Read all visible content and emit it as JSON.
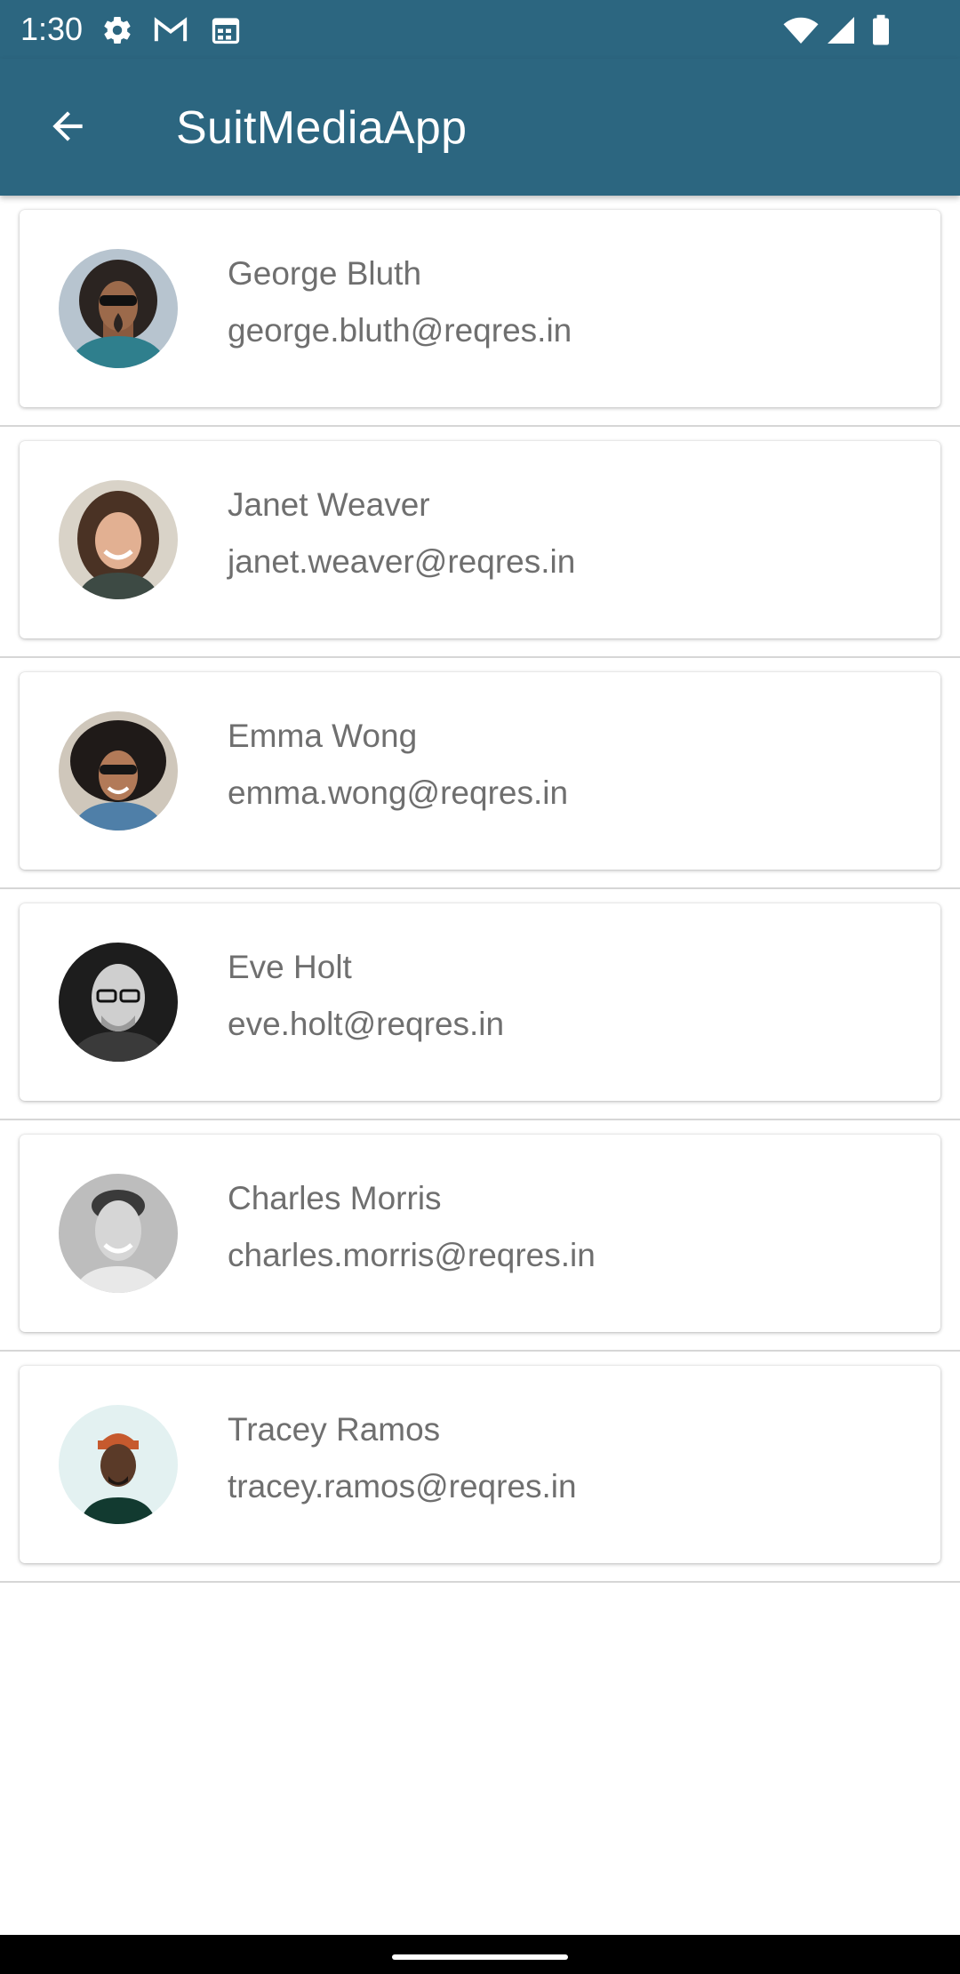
{
  "status_bar": {
    "time": "1:30",
    "icons": [
      "gear-icon",
      "gmail-icon",
      "calendar-icon",
      "wifi-icon",
      "signal-icon",
      "battery-icon"
    ]
  },
  "app_bar": {
    "title": "SuitMediaApp",
    "back_icon": "arrow-back-icon",
    "background_color": "#2c6680"
  },
  "users": [
    {
      "name": "George Bluth",
      "email": "george.bluth@reqres.in"
    },
    {
      "name": "Janet Weaver",
      "email": "janet.weaver@reqres.in"
    },
    {
      "name": "Emma Wong",
      "email": "emma.wong@reqres.in"
    },
    {
      "name": "Eve Holt",
      "email": "eve.holt@reqres.in"
    },
    {
      "name": "Charles Morris",
      "email": "charles.morris@reqres.in"
    },
    {
      "name": "Tracey Ramos",
      "email": "tracey.ramos@reqres.in"
    }
  ],
  "colors": {
    "accent": "#2c6680",
    "text_secondary": "#6f6f6f",
    "divider": "#d6d6d6"
  }
}
